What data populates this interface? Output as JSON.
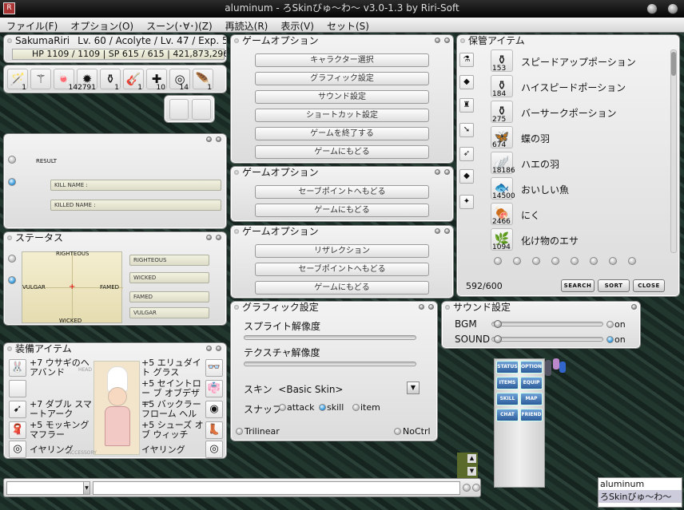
{
  "window": {
    "title": "aluminum - ろSkinびゅ〜わ〜 v3.0-1.3 by Riri-Soft"
  },
  "menu": [
    "ファイル(F)",
    "オプション(O)",
    "スーン(･∀･)(Z)",
    "再読込(R)",
    "表示(V)",
    "セット(S)"
  ],
  "char": {
    "name": "SakumaRiri",
    "info": "Lv. 60 / Acolyte / Lv. 47 / Exp. 50 %",
    "hp_label": "HP",
    "hp": "1109 / 1109",
    "sp_label": "SP",
    "sp": "615 / 615",
    "zeny": "421,873,296 Z"
  },
  "hotbar": [
    {
      "icon": "wand-icon",
      "glyph": "🪄",
      "qty": "1"
    },
    {
      "icon": "staff-icon",
      "glyph": "⚚",
      "qty": ""
    },
    {
      "icon": "candy-icon",
      "glyph": "🍬",
      "qty": ""
    },
    {
      "icon": "urchin-icon",
      "glyph": "✹",
      "qty": "142791"
    },
    {
      "icon": "potion-icon",
      "glyph": "⚱",
      "qty": "1"
    },
    {
      "icon": "guitar-icon",
      "glyph": "🎸",
      "qty": "1"
    },
    {
      "icon": "heal-icon",
      "glyph": "✚",
      "qty": "10"
    },
    {
      "icon": "shell-icon",
      "glyph": "◎",
      "qty": "14"
    },
    {
      "icon": "wing-icon",
      "glyph": "🪶",
      "qty": "1"
    }
  ],
  "result": {
    "label": "RESULT",
    "kill_label": "KILL NAME :",
    "killed_label": "KILLED NAME :"
  },
  "game_opt1": {
    "title": "ゲームオプション",
    "buttons": [
      "キャラクター選択",
      "グラフィック設定",
      "サウンド設定",
      "ショートカット設定",
      "ゲームを終了する",
      "ゲームにもどる"
    ]
  },
  "game_opt2": {
    "title": "ゲームオプション",
    "buttons": [
      "セーブポイントへもどる",
      "ゲームにもどる"
    ]
  },
  "game_opt3": {
    "title": "ゲームオプション",
    "buttons": [
      "リザレクション",
      "セーブポイントへもどる",
      "ゲームにもどる"
    ]
  },
  "status": {
    "title": "ステータス",
    "top": "RIGHTEOUS",
    "bottom": "WICKED",
    "left": "VULGAR",
    "right": "FAMED",
    "fields": [
      "RIGHTEOUS",
      "WICKED",
      "FAMED",
      "VULGAR"
    ]
  },
  "equip": {
    "title": "装備アイテム",
    "left": [
      "+7 ウサギのヘアバンド",
      "",
      "+7 ダブル スマートアーク",
      "+5 モッキング マフラー",
      "イヤリング"
    ],
    "right": [
      "+5 エリュダイト グラス",
      "+5 セイントロー ブ オブデザー",
      "+5 バックラー フローム ヘル",
      "+5 シューズ オブ ウィッチ",
      "イヤリング"
    ],
    "slot_labels": [
      "HEAD",
      "",
      "",
      "",
      "ACCESSORY"
    ]
  },
  "storage": {
    "title": "保管アイテム",
    "items": [
      {
        "name": "スピードアップポーション",
        "qty": "153",
        "icon": "speed-potion-icon",
        "glyph": "⚱"
      },
      {
        "name": "ハイスピードポーション",
        "qty": "184",
        "icon": "high-speed-potion-icon",
        "glyph": "⚱"
      },
      {
        "name": "バーサークポーション",
        "qty": "275",
        "icon": "berserk-potion-icon",
        "glyph": "⚱"
      },
      {
        "name": "蝶の羽",
        "qty": "674",
        "icon": "butterfly-wing-icon",
        "glyph": "🦋"
      },
      {
        "name": "ハエの羽",
        "qty": "18186",
        "icon": "fly-wing-icon",
        "glyph": "🪽"
      },
      {
        "name": "おいしい魚",
        "qty": "14500",
        "icon": "fish-icon",
        "glyph": "🐟"
      },
      {
        "name": "にく",
        "qty": "2466",
        "icon": "meat-icon",
        "glyph": "🍖"
      },
      {
        "name": "化け物のエサ",
        "qty": "1094",
        "icon": "monster-food-icon",
        "glyph": "🌿"
      }
    ],
    "count": "592/600",
    "buttons": [
      "SEARCH",
      "SORT",
      "CLOSE"
    ]
  },
  "graphics": {
    "title": "グラフィック設定",
    "sprite": "スプライト解像度",
    "texture": "テクスチャ解像度",
    "skin_label": "スキン",
    "skin_value": "<Basic Skin>",
    "snap_label": "スナップ",
    "snap_opts": [
      "attack",
      "skill",
      "item"
    ],
    "trilinear": "Trilinear",
    "noctrl": "NoCtrl"
  },
  "sound": {
    "title": "サウンド設定",
    "bgm": "BGM",
    "sound": "SOUND",
    "on": "on"
  },
  "hudbtns": [
    "STATUS",
    "OPTION",
    "ITEMS",
    "EQUIP",
    "SKILL",
    "MAP",
    "CHAT",
    "FRIEND"
  ],
  "chat": {
    "target": "aluminum",
    "skinname": "ろSkinびゅ〜わ〜"
  }
}
